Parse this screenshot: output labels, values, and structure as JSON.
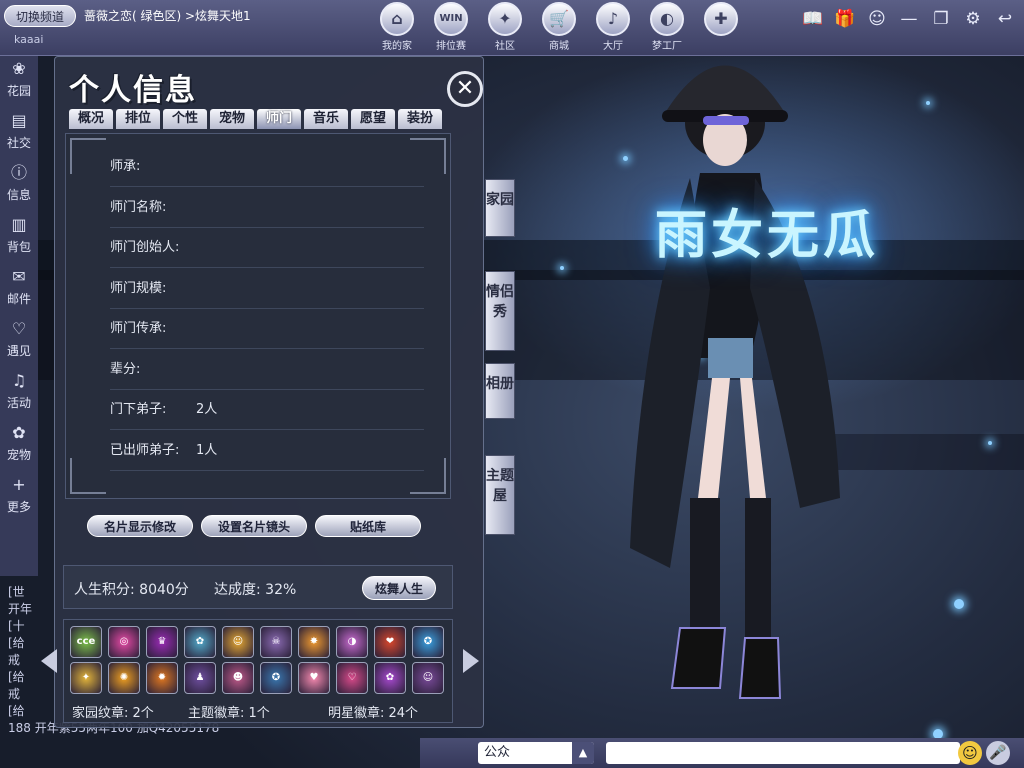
{
  "topbar": {
    "channel_button": "切换频道",
    "breadcrumb": "蔷薇之恋( 绿色区) >炫舞天地1",
    "user_name": "kaaai",
    "nav": [
      {
        "label": "我的家",
        "icon": "house-icon",
        "glyph": "⌂"
      },
      {
        "label": "排位赛",
        "icon": "win-icon",
        "glyph": "WIN"
      },
      {
        "label": "社区",
        "icon": "community-icon",
        "glyph": "✦"
      },
      {
        "label": "商城",
        "icon": "cart-icon",
        "glyph": "🛒"
      },
      {
        "label": "大厅",
        "icon": "music-icon",
        "glyph": "♪"
      },
      {
        "label": "梦工厂",
        "icon": "dream-icon",
        "glyph": "◐"
      },
      {
        "label": "",
        "icon": "wheel-icon",
        "glyph": "✚"
      }
    ],
    "tools": [
      {
        "icon": "book-icon",
        "glyph": "📖"
      },
      {
        "icon": "gift-icon",
        "glyph": "🎁"
      },
      {
        "icon": "face-icon",
        "glyph": "☺"
      },
      {
        "icon": "minimize-icon",
        "glyph": "—"
      },
      {
        "icon": "restore-icon",
        "glyph": "❐"
      },
      {
        "icon": "settings-icon",
        "glyph": "⚙"
      },
      {
        "icon": "back-icon",
        "glyph": "↩"
      }
    ]
  },
  "rail": [
    {
      "label": "花园",
      "icon": "flower-icon",
      "glyph": "❀"
    },
    {
      "label": "社交",
      "icon": "chat-icon",
      "glyph": "▤"
    },
    {
      "label": "信息",
      "icon": "info-icon",
      "glyph": "ⓘ"
    },
    {
      "label": "背包",
      "icon": "bag-icon",
      "glyph": "▥"
    },
    {
      "label": "邮件",
      "icon": "mail-icon",
      "glyph": "✉"
    },
    {
      "label": "遇见",
      "icon": "heart-icon",
      "glyph": "♡"
    },
    {
      "label": "活动",
      "icon": "activity-icon",
      "glyph": "♫"
    },
    {
      "label": "宠物",
      "icon": "paw-icon",
      "glyph": "✿"
    },
    {
      "label": "更多",
      "icon": "plus-icon",
      "glyph": "+"
    }
  ],
  "chat_log": [
    "[世",
    "开年",
    "[十",
    "[给",
    "戒",
    "[给",
    "戒",
    "[给",
    "188 开年紫55两年100 加Q42055178"
  ],
  "panel": {
    "title": "个人信息",
    "close_glyph": "✕",
    "tabs": [
      "概况",
      "排位",
      "个性",
      "宠物",
      "师门",
      "音乐",
      "愿望",
      "装扮"
    ],
    "active_tab": "师门",
    "rows": [
      {
        "label": "师承:",
        "value": ""
      },
      {
        "label": "师门名称:",
        "value": ""
      },
      {
        "label": "师门创始人:",
        "value": ""
      },
      {
        "label": "师门规模:",
        "value": ""
      },
      {
        "label": "师门传承:",
        "value": ""
      },
      {
        "label": "辈分:",
        "value": ""
      },
      {
        "label": "门下弟子:",
        "value": "2人"
      },
      {
        "label": "已出师弟子:",
        "value": "1人"
      }
    ],
    "side_tabs": [
      "家园",
      "情侣秀",
      "相册",
      "主题屋"
    ],
    "actions": [
      "名片显示修改",
      "设置名片镜头",
      "贴纸库"
    ],
    "score": {
      "life_points": "人生积分: 8040分",
      "completion": "达成度:  32%",
      "life_button": "炫舞人生"
    },
    "badges": [
      "cce",
      "◎",
      "♛",
      "✿",
      "☺",
      "☠",
      "✸",
      "◑",
      "❤",
      "✪",
      "✦",
      "✺",
      "✹",
      "♟",
      "☻",
      "✪",
      "♥",
      "♡",
      "✿",
      "☺"
    ],
    "badge_stats": [
      "家园纹章: 2个",
      "主题徽章: 1个",
      "明星徽章: 24个"
    ]
  },
  "character": {
    "name_title": "雨女无瓜"
  },
  "bottom": {
    "channel": "公众",
    "arrow_glyph": "▲",
    "emoji_glyph": "☺",
    "mic_glyph": "🎤"
  },
  "colors": {
    "accent_glow": "#6fd3ff",
    "panel_bg": "#2c3244",
    "topbar": "#4a4e73"
  }
}
